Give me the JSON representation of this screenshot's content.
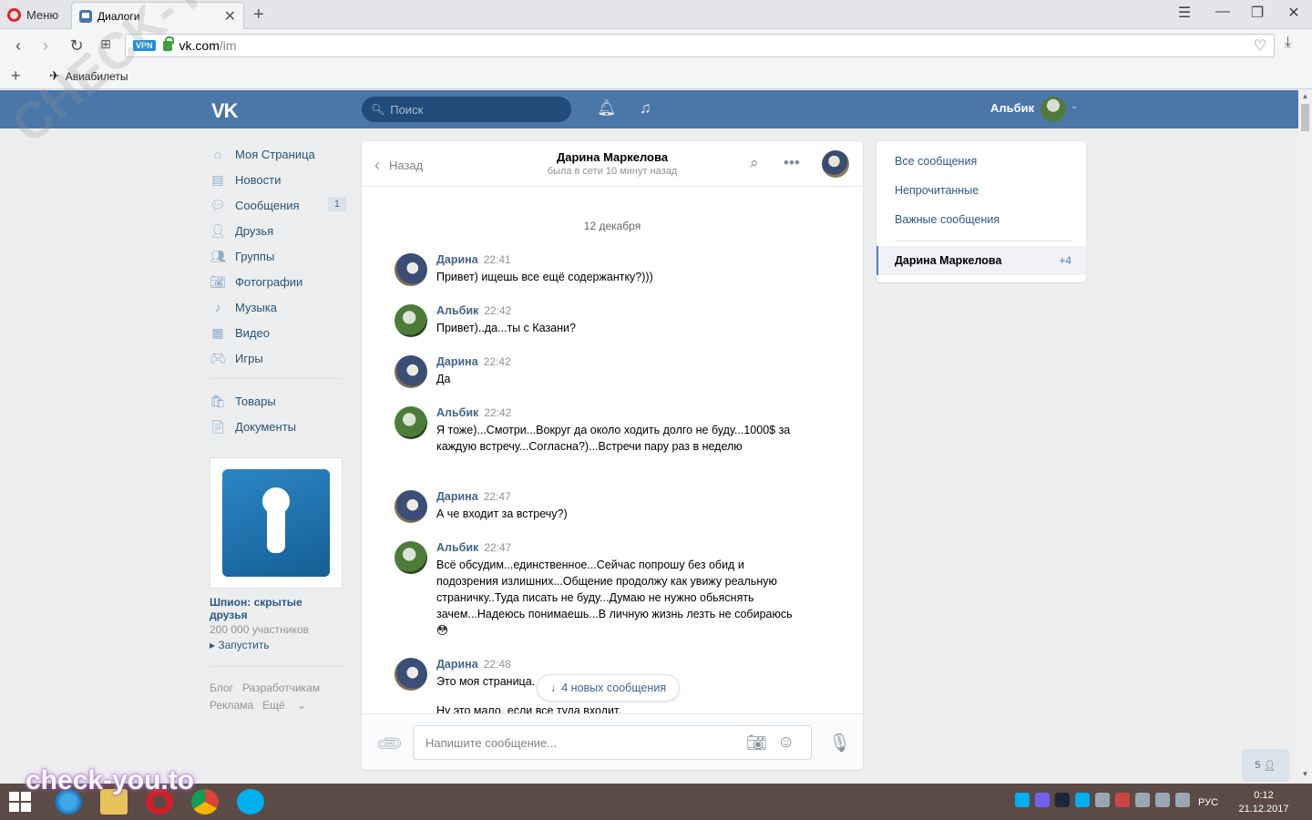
{
  "browser": {
    "menu_label": "Меню",
    "tab_title": "Диалоги",
    "new_tab_symbol": "+",
    "url_domain": "vk.com",
    "url_path": "/im",
    "vpn_label": "VPN",
    "bookmark_label": "Авиабилеты"
  },
  "header": {
    "logo": "VK",
    "search_placeholder": "Поиск",
    "user_name": "Альбик"
  },
  "left_menu": {
    "items": [
      {
        "label": "Моя Страница",
        "icon": "home-icon"
      },
      {
        "label": "Новости",
        "icon": "news-icon"
      },
      {
        "label": "Сообщения",
        "icon": "messages-icon",
        "badge": "1"
      },
      {
        "label": "Друзья",
        "icon": "friends-icon"
      },
      {
        "label": "Группы",
        "icon": "groups-icon"
      },
      {
        "label": "Фотографии",
        "icon": "photo-icon"
      },
      {
        "label": "Музыка",
        "icon": "music-icon"
      },
      {
        "label": "Видео",
        "icon": "video-icon"
      },
      {
        "label": "Игры",
        "icon": "games-icon"
      }
    ],
    "items2": [
      {
        "label": "Товары",
        "icon": "goods-icon"
      },
      {
        "label": "Документы",
        "icon": "docs-icon"
      }
    ],
    "ad": {
      "title": "Шпион: скрытые друзья",
      "subtitle": "200 000 участников",
      "action": "Запустить"
    },
    "footer": [
      "Блог",
      "Разработчикам",
      "Реклама",
      "Ещё"
    ]
  },
  "chat": {
    "back_label": "Назад",
    "peer_name": "Дарина Маркелова",
    "peer_status": "была в сети 10 минут назад",
    "date": "12 декабря",
    "messages": [
      {
        "author": "Дарина",
        "time": "22:41",
        "text": "Привет) ищешь все ещё содержантку?)))"
      },
      {
        "author": "Альбик",
        "time": "22:42",
        "text": "Привет)..да...ты с Казани?"
      },
      {
        "author": "Дарина",
        "time": "22:42",
        "text": "Да"
      },
      {
        "author": "Альбик",
        "time": "22:42",
        "text": "Я тоже)...Смотри...Вокруг да около ходить долго не буду...1000$ за каждую встречу...Согласна?)...Встречи пару раз в неделю"
      },
      {
        "author": "Дарина",
        "time": "22:47",
        "text": "А че входит за встречу?)"
      },
      {
        "author": "Альбик",
        "time": "22:47",
        "text": "Всё обсудим...единственное...Сейчас попрошу без обид и подозрения излишних...Общение продолжу как увижу реальную страничку..Туда писать не буду...Думаю не нужно обьяснять зачем...Надеюсь понимаешь...В личную жизнь лезть не собираюсь😳"
      },
      {
        "author": "Дарина",
        "time": "22:48",
        "text": "Это моя страница.",
        "text2": "Ну это мало, если все туда входит."
      }
    ],
    "new_messages_label": "4 новых сообщения",
    "input_placeholder": "Напишите сообщение..."
  },
  "right_panel": {
    "filters": [
      "Все сообщения",
      "Непрочитанные",
      "Важные сообщения"
    ],
    "active_name": "Дарина Маркелова",
    "active_count": "+4"
  },
  "online_count": "5",
  "taskbar": {
    "lang": "РУС",
    "time": "0:12",
    "date": "21.12.2017"
  },
  "watermark": "check-you.to",
  "watermark_diag": "CHECK-YOU.ME"
}
